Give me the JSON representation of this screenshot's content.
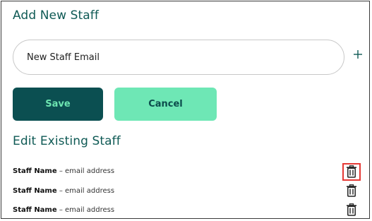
{
  "add_section": {
    "title": "Add New Staff",
    "email_placeholder": "New Staff Email",
    "add_icon": "plus-icon",
    "save_label": "Save",
    "cancel_label": "Cancel"
  },
  "edit_section": {
    "title": "Edit Existing Staff",
    "staff": [
      {
        "name": "Staff Name",
        "detail": " – email address",
        "action_icon": "trash-icon",
        "highlighted": true
      },
      {
        "name": "Staff Name",
        "detail": " – email address",
        "action_icon": "trash-icon",
        "highlighted": false
      },
      {
        "name": "Staff Name",
        "detail": " – email address",
        "action_icon": "trash-icon",
        "highlighted": false
      }
    ]
  },
  "colors": {
    "heading": "#0f5a55",
    "save_bg": "#0b4f51",
    "save_text": "#6de5b1",
    "cancel_bg": "#6ee7b5",
    "highlight": "#e53935"
  }
}
